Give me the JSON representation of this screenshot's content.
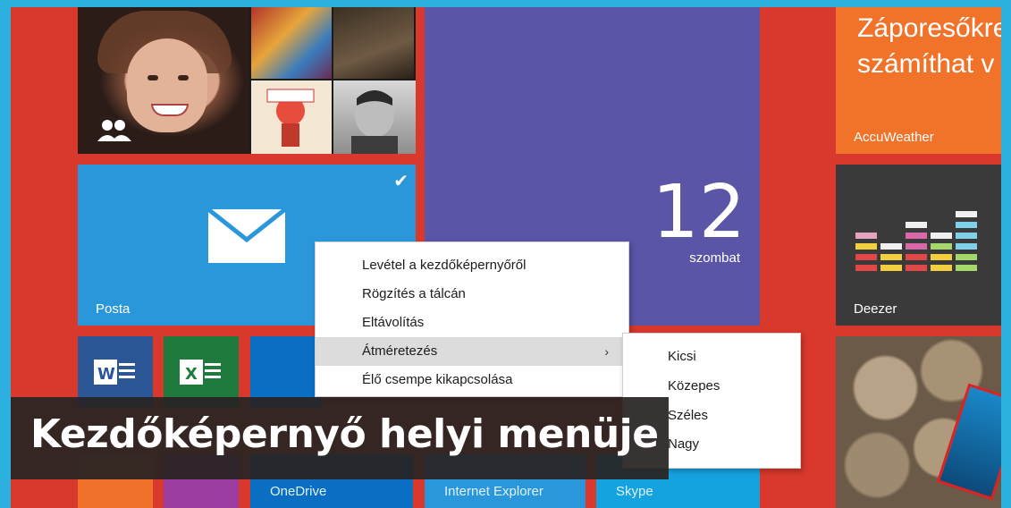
{
  "tiles": {
    "people": {
      "name": "People"
    },
    "mail": {
      "label": "Posta"
    },
    "calendar": {
      "day_number": "12",
      "day_name": "szombat"
    },
    "weather": {
      "headline": "Záporesőkre számíthat v",
      "headline_line1": "Záporesőkre",
      "headline_line2": "számíthat v",
      "label": "AccuWeather"
    },
    "deezer": {
      "label": "Deezer"
    },
    "onedrive": {
      "label": "OneDrive"
    },
    "internet_explorer": {
      "label": "Internet Explorer"
    },
    "skype": {
      "label": "Skype"
    }
  },
  "context_menu": {
    "items": [
      {
        "label": "Levétel a kezdőképernyőről"
      },
      {
        "label": "Rögzítés a tálcán"
      },
      {
        "label": "Eltávolítás"
      },
      {
        "label": "Átméretezés",
        "has_submenu": true,
        "submenu_arrow": "›"
      },
      {
        "label": "Élő csempe kikapcsolása"
      }
    ]
  },
  "resize_submenu": {
    "items": [
      {
        "label": "Kicsi"
      },
      {
        "label": "Közepes"
      },
      {
        "label": "Széles"
      },
      {
        "label": "Nagy"
      }
    ]
  },
  "caption": {
    "text": "Kezdőképernyő helyi menüje"
  },
  "colors": {
    "screen_background": "#d8392c",
    "frame": "#2bb0df",
    "mail_tile": "#2b97db",
    "calendar_tile": "#5a55a7",
    "weather_tile": "#f1732a",
    "deezer_tile": "#3a3a3a"
  }
}
